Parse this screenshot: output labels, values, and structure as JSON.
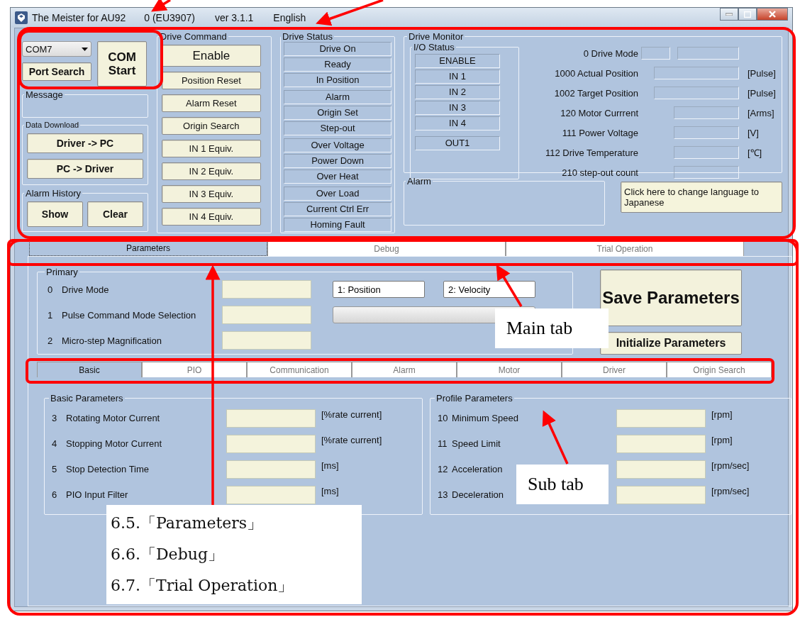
{
  "window": {
    "title_parts": [
      "The Meister for AU92",
      "0 (EU3907)"
    ],
    "version": "ver 3.1.1",
    "language": "English"
  },
  "connection": {
    "port": "COM7",
    "port_search": "Port Search",
    "com_start": "COM Start"
  },
  "message": {
    "title": "Message"
  },
  "data_download": {
    "title": "Data Download",
    "buttons": [
      "Driver -> PC",
      "PC -> Driver"
    ]
  },
  "alarm_history": {
    "title": "Alarm History",
    "buttons": [
      "Show",
      "Clear"
    ]
  },
  "drive_command": {
    "title": "Drive Command",
    "enable_button": "Enable",
    "buttons": [
      "Position Reset",
      "Alarm Reset",
      "Origin Search",
      "IN 1 Equiv.",
      "IN 2 Equiv.",
      "IN 3 Equiv.",
      "IN 4 Equiv."
    ]
  },
  "drive_status": {
    "title": "Drive Status",
    "groups": [
      [
        "Drive On",
        "Ready",
        "In Position"
      ],
      [
        "Alarm",
        "Origin Set",
        "Step-out"
      ],
      [
        "Over Voltage",
        "Power Down",
        "Over Heat"
      ],
      [
        "Over Load",
        "Current Ctrl Err",
        "Homing Fault"
      ]
    ]
  },
  "drive_monitor": {
    "title": "Drive Monitor",
    "io_status": {
      "title": "I/O Status",
      "groups": [
        [
          "ENABLE",
          "IN 1",
          "IN 2",
          "IN 3",
          "IN 4"
        ],
        [
          "OUT1"
        ]
      ]
    },
    "readouts": [
      {
        "label": "0 Drive Mode",
        "kind": "dual"
      },
      {
        "label": "1000 Actual Position",
        "kind": "wide",
        "unit": "[Pulse]"
      },
      {
        "label": "1002 Target Position",
        "kind": "wide",
        "unit": "[Pulse]"
      },
      {
        "label": "120 Motor Currrent",
        "kind": "short",
        "unit": "[Arms]"
      },
      {
        "label": "111 Power Voltage",
        "kind": "short",
        "unit": "[V]"
      },
      {
        "label": "112 Drive Temperature",
        "kind": "short",
        "unit": "[℃]"
      },
      {
        "label": "210 step-out count",
        "kind": "short"
      }
    ]
  },
  "alarm": {
    "title": "Alarm"
  },
  "language_button": "Click here to change language to Japanese",
  "main_tabs": [
    {
      "label": "Parameters",
      "selected": true
    },
    {
      "label": "Debug",
      "selected": false
    },
    {
      "label": "Trial Operation",
      "selected": false
    }
  ],
  "primary": {
    "title": "Primary",
    "params": [
      {
        "number": "0",
        "label": "Drive Mode"
      },
      {
        "number": "1",
        "label": "Pulse Command Mode Selection"
      },
      {
        "number": "2",
        "label": "Micro-step Magnification"
      }
    ],
    "options": [
      "1: Position",
      "2: Velocity"
    ]
  },
  "save_button": "Save Parameters",
  "initialize_button": "Initialize Parameters",
  "sub_tabs": [
    {
      "label": "Basic",
      "selected": true
    },
    {
      "label": "PIO",
      "selected": false
    },
    {
      "label": "Communication",
      "selected": false
    },
    {
      "label": "Alarm",
      "selected": false
    },
    {
      "label": "Motor",
      "selected": false
    },
    {
      "label": "Driver",
      "selected": false
    },
    {
      "label": "Origin Search",
      "selected": false
    }
  ],
  "basic_parameters": {
    "title": "Basic Parameters",
    "params": [
      {
        "number": "3",
        "label": "Rotating Motor Current",
        "unit": "[%rate current]"
      },
      {
        "number": "4",
        "label": "Stopping Motor Current",
        "unit": "[%rate current]"
      },
      {
        "number": "5",
        "label": "Stop Detection Time",
        "unit": "[ms]"
      },
      {
        "number": "6",
        "label": "PIO Input Filter",
        "unit": "[ms]"
      }
    ]
  },
  "profile_parameters": {
    "title": "Profile Parameters",
    "params": [
      {
        "number": "10",
        "label": "Minimum Speed",
        "unit": "[rpm]"
      },
      {
        "number": "11",
        "label": "Speed Limit",
        "unit": "[rpm]"
      },
      {
        "number": "12",
        "label": "Acceleration",
        "unit": "[rpm/sec]"
      },
      {
        "number": "13",
        "label": "Deceleration",
        "unit": "[rpm/sec]"
      }
    ]
  },
  "annotations": {
    "main_tab_label": "Main tab",
    "sub_tab_label": "Sub tab",
    "sections": [
      "6.5.「Parameters」",
      "6.6.「Debug」",
      "6.7.「Trial Operation」"
    ]
  }
}
